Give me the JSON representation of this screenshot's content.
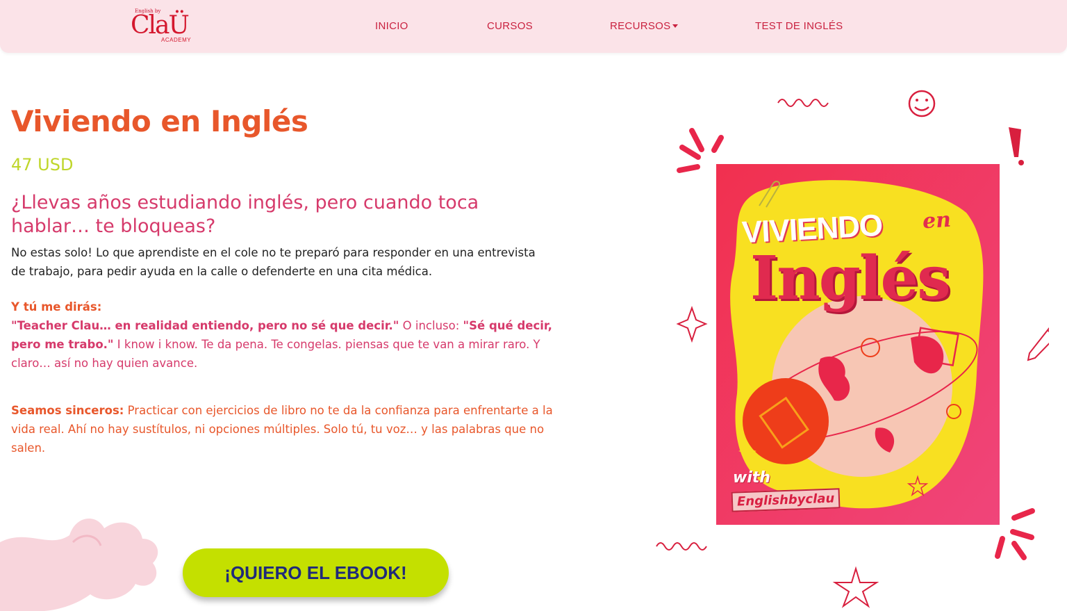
{
  "brand": {
    "logo_top": "English by",
    "logo_main": "ClaÜ",
    "logo_sub": "ACADEMY"
  },
  "nav": {
    "items": [
      {
        "label": "INICIO"
      },
      {
        "label": "CURSOS"
      },
      {
        "label": "RECURSOS"
      },
      {
        "label": "TEST DE INGLÉS"
      }
    ]
  },
  "product": {
    "title": "Viviendo en Inglés",
    "price": "47 USD",
    "headline": "¿Llevas años estudiando inglés, pero cuando toca hablar… te bloqueas?",
    "p1": "No estas solo! Lo que aprendiste en el cole no te preparó para responder en una entrevista de trabajo, para pedir ayuda en la calle o defenderte en una cita médica.",
    "p2": {
      "ask": "Y tú me dirás:",
      "quote1": "\"Teacher Clau… en realidad entiendo, pero no sé que decir.\"",
      "mid": " O incluso: ",
      "quote2": "\"Sé qué decir, pero me trabo.\"",
      "rest": " I know i know. Te da pena. Te congelas. piensas que te van a mirar raro. Y claro… así no hay quien avance."
    },
    "p3": {
      "lead": "Seamos sinceros:",
      "rest": " Practicar con ejercicios de libro no te da la confianza para enfrentarte a la vida real. Ahí no hay sustítulos, ni opciones múltiples. Solo tú, tu voz… y las palabras que no salen."
    },
    "cta": "¡QUIERO EL EBOOK!"
  },
  "cover": {
    "line1": "VIVIENDO",
    "en": "en",
    "line2": "Inglés",
    "with": "with",
    "brand": "Englishbyclau"
  },
  "colors": {
    "nav_bg": "#fbe3e8",
    "nav_text": "#c9213f",
    "title": "#e8572b",
    "price": "#bfd62a",
    "headline": "#d63a6b",
    "cta_bg": "#c4e000",
    "cta_text": "#1f2a7a"
  },
  "icons": [
    "smiley-icon",
    "exclamation-icon",
    "sparkle-icon",
    "pencil-icon",
    "star-icon",
    "squiggle-icon",
    "burst-icon"
  ]
}
